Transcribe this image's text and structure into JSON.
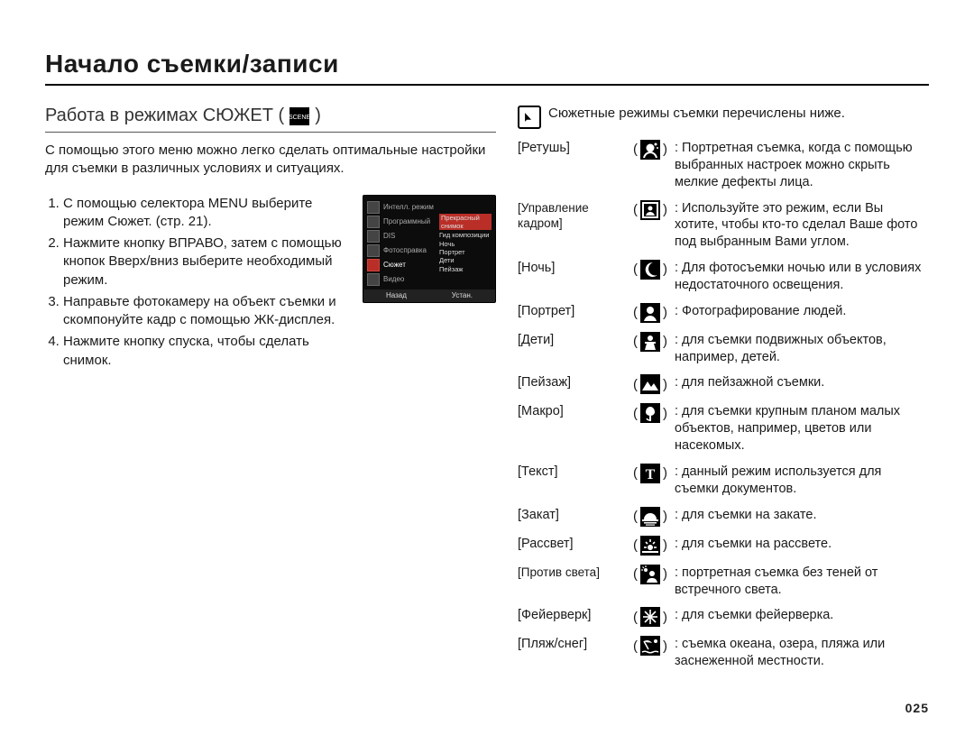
{
  "title": "Начало съемки/записи",
  "page_number": "025",
  "subtitle_pre": "Работа в режимах СЮЖЕТ (",
  "subtitle_post": " )",
  "intro": "С помощью этого меню можно легко сделать оптимальные настройки для съемки в различных условиях и ситуациях.",
  "steps": [
    "С помощью селектора MENU выберите режим Сюжет. (стр. 21).",
    "Нажмите кнопку ВПРАВО, затем с помощью кнопок Вверх/вниз выберите необходимый режим.",
    "Направьте фотокамеру на объект съемки и скомпонуйте кадр с помощью ЖК-дисплея.",
    "Нажмите кнопку спуска, чтобы сделать снимок."
  ],
  "lcd": {
    "left_items": [
      "Интелл. режим",
      "Программный",
      "DIS",
      "Фотосправка",
      "Сюжет",
      "Видео"
    ],
    "highlight_index": 4,
    "side_selected": "Прекрасный снимок",
    "side_items": [
      "Гид композиции",
      "Ночь",
      "Портрет",
      "Дети",
      "Пейзаж"
    ],
    "back": "Назад",
    "set": "Устан."
  },
  "note_text": "Сюжетные режимы съемки перечислены ниже.",
  "modes": [
    {
      "label": "[Ретушь]",
      "desc": ": Портретная съемка, когда с помощью выбранных настроек можно скрыть мелкие дефекты лица."
    },
    {
      "label": "[Управление кадром]",
      "tight": true,
      "desc": ": Используйте это режим, если Вы хотите, чтобы кто-то сделал Ваше фото под выбранным Вами углом."
    },
    {
      "label": "[Ночь]",
      "desc": ": Для фотосъемки ночью или в условиях недостаточного освещения."
    },
    {
      "label": "[Портрет]",
      "desc": ": Фотографирование людей."
    },
    {
      "label": "[Дети]",
      "desc": ": для съемки подвижных объектов,  например, детей."
    },
    {
      "label": "[Пейзаж]",
      "desc": ": для пейзажной съемки."
    },
    {
      "label": "[Макро]",
      "desc": ": для съемки крупным планом малых объектов, например, цветов или насекомых."
    },
    {
      "label": "[Текст]",
      "desc": ": данный режим используется для съемки документов."
    },
    {
      "label": "[Закат]",
      "desc": ": для съемки на закате."
    },
    {
      "label": "[Рассвет]",
      "desc": ": для съемки на рассвете."
    },
    {
      "label": "[Против света]",
      "tight": true,
      "desc": ": портретная съемка без теней от встречного света."
    },
    {
      "label": "[Фейерверк]",
      "desc": ": для съемки фейерверка."
    },
    {
      "label": "[Пляж/снег]",
      "desc": ": съемка океана, озера, пляжа или заснеженной местности."
    }
  ],
  "mode_icons": [
    "retouch",
    "frame",
    "night",
    "portrait",
    "children",
    "landscape",
    "macro",
    "text",
    "sunset",
    "dawn",
    "backlight",
    "firework",
    "beach"
  ]
}
